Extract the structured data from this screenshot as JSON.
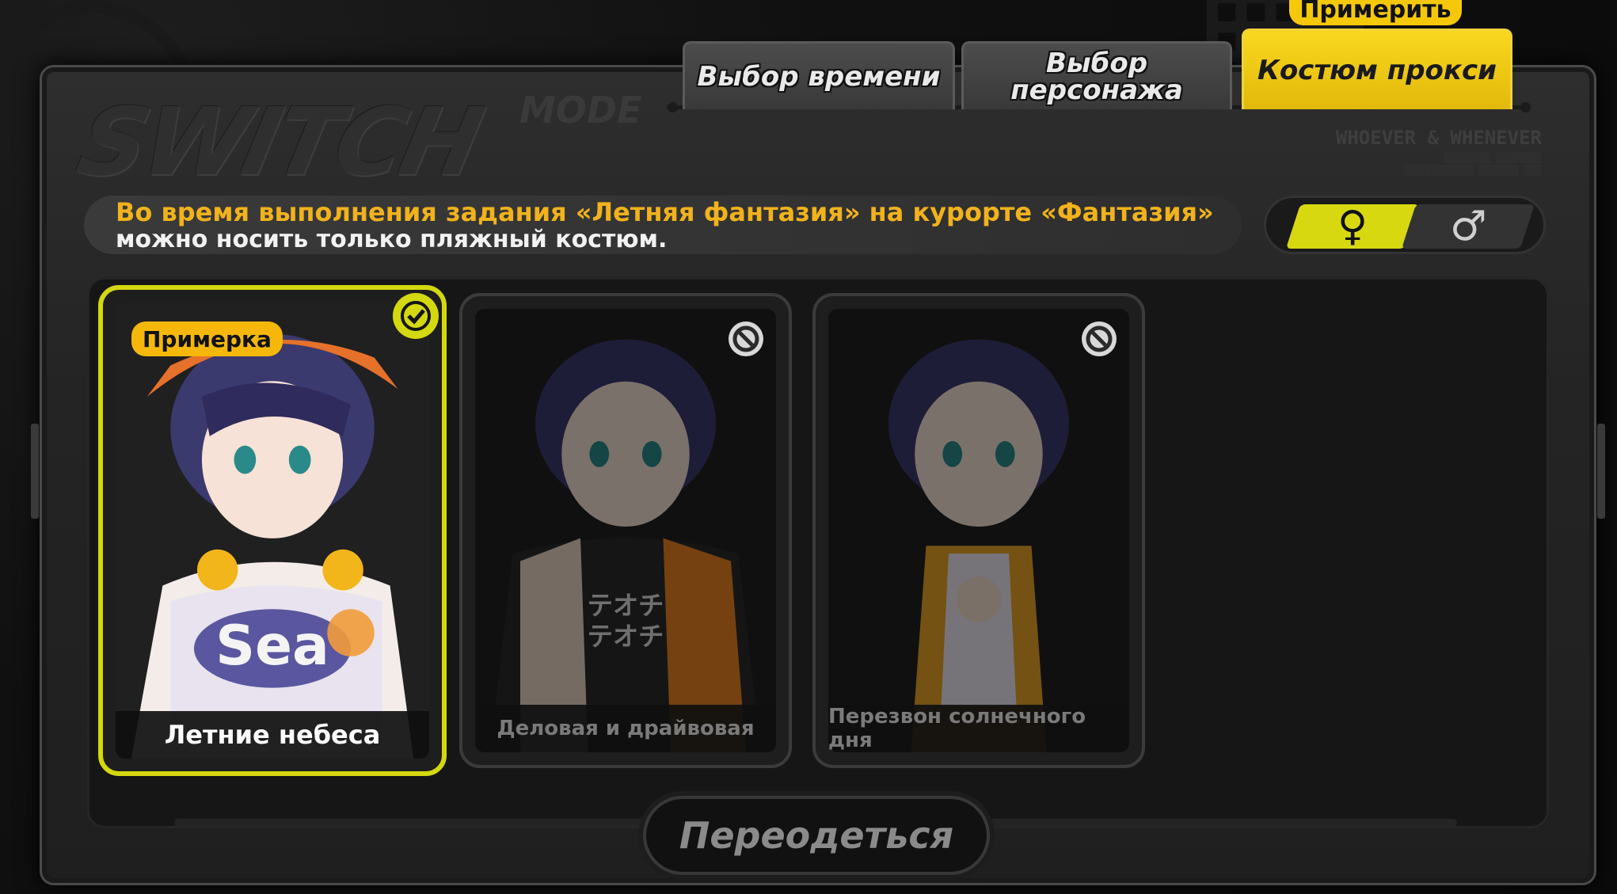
{
  "header": {
    "logo_text": "SWITCH",
    "logo_mode": "MODE",
    "brand_line1": "WHOEVER & WHENEVER",
    "brand_line2": "",
    "brand_line3": ""
  },
  "tabs": [
    {
      "label": "Выбор времени",
      "active": false
    },
    {
      "label": "Выбор\nперсонажа",
      "active": false
    },
    {
      "label": "Костюм прокси",
      "active": true
    }
  ],
  "tryon_badge": "Примерить",
  "notice": {
    "line1": "Во время выполнения задания «Летняя фантазия» на курорте «Фантазия»",
    "line2": "можно носить только пляжный костюм."
  },
  "gender_switch": {
    "female_symbol": "♀",
    "male_symbol": "♂",
    "selected": "female"
  },
  "outfits": [
    {
      "name": "Летние небеса",
      "tag": "Примерка",
      "state": "selected"
    },
    {
      "name": "Деловая и драйвовая",
      "state": "unavailable"
    },
    {
      "name": "Перезвон солнечного дня",
      "state": "unavailable"
    }
  ],
  "action_button": "Переодеться",
  "colors": {
    "accent_yellow": "#f5c80a",
    "selection_lime": "#d4d80e",
    "notice_orange": "#f1b21b"
  }
}
